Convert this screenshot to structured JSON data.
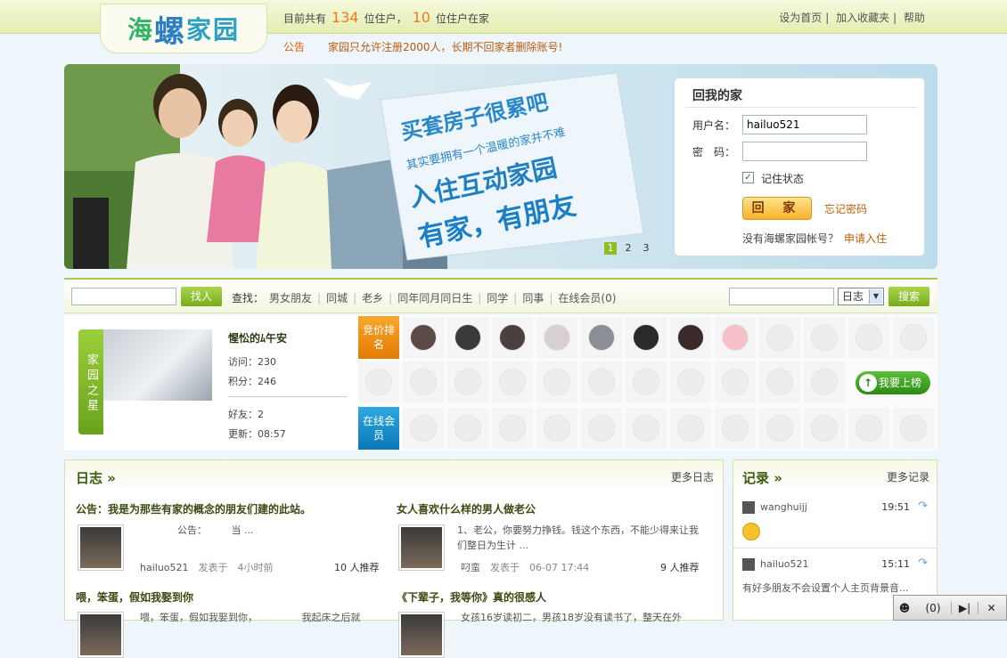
{
  "header": {
    "logo": "海螺家园",
    "stats_prefix": "目前共有",
    "users_total": "134",
    "users_unit": "位住户，",
    "users_online": "10",
    "online_unit": "位住户在家",
    "links": [
      "设为首页",
      "加入收藏夹",
      "帮助"
    ]
  },
  "notice": {
    "label": "公告",
    "text": "家园只允许注册2000人，长期不回家者删除账号!"
  },
  "banner": {
    "slogan1": "买套房子很累吧",
    "slogan2": "其实要拥有一个温暖的家并不难",
    "slogan3": "入住互动家园",
    "slogan4": "有家，有朋友",
    "dots": [
      "1",
      "2",
      "3"
    ]
  },
  "login": {
    "title": "回我的家",
    "username_label": "用户名：",
    "username_value": "hailuo521",
    "password_label": "密　码：",
    "remember_label": "记住状态",
    "submit": "回 家",
    "forgot": "忘记密码",
    "no_account": "没有海螺家园帐号？",
    "register": "申请入住"
  },
  "search": {
    "find_btn": "找人",
    "find_label": "查找：",
    "quick_links": [
      "男女朋友",
      "同城",
      "老乡",
      "同年同月同日生",
      "同学",
      "同事",
      "在线会员(0)"
    ],
    "type_selected": "日志",
    "search_btn": "搜索"
  },
  "star": {
    "tab": "家园之星",
    "name": "惺忪的ﾑ午安",
    "visits": "访问：230",
    "points": "积分：246",
    "friends": "好友：2",
    "updated": "更新：08:57"
  },
  "ranking": {
    "rank_label": "竞价排名",
    "online_label": "在线会员",
    "up_btn": "我要上榜"
  },
  "blog": {
    "title": "日志",
    "more": "更多日志",
    "posts": [
      {
        "title": "公告：我是为那些有家的概念的朋友们建的此站。",
        "excerpt": "公告：　　　当 ...",
        "author": "hailuo521",
        "time": "发表于　4小时前",
        "votes": "10",
        "votes_unit": "人推荐"
      },
      {
        "title": "女人喜欢什么样的男人做老公",
        "excerpt": "1、老公，你要努力挣钱。钱这个东西，不能少得来让我们整日为生计 ...",
        "author": "叼蛮",
        "time": "发表于　06-07 17:44",
        "votes": "9",
        "votes_unit": "人推荐"
      },
      {
        "title": "喂，笨蛋，假如我娶到你",
        "excerpt": "喂，笨蛋，假如我娶到你，　　　　　我起床之后就"
      },
      {
        "title": "《下辈子，我等你》真的很感人",
        "excerpt": "女孩16岁读初二，男孩18岁没有读书了，整天在外"
      }
    ]
  },
  "records": {
    "title": "记录",
    "more": "更多记录",
    "items": [
      {
        "user": "wanghuijj",
        "time": "19:51"
      },
      {
        "user": "hailuo521",
        "time": "15:11",
        "text": "有好多朋友不会设置个人主页背景音..."
      }
    ]
  },
  "tray": {
    "count": "(0)"
  }
}
